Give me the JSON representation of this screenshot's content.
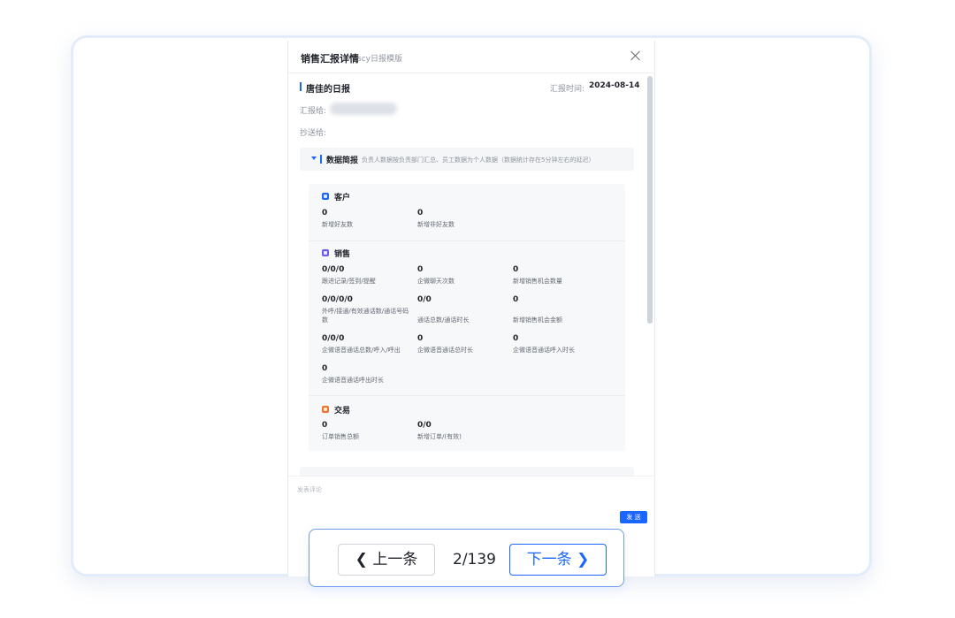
{
  "panel": {
    "title": "销售汇报详情",
    "subtitle": "scy日报模版"
  },
  "report": {
    "name": "唐佳的日报",
    "time_label": "汇报时间:",
    "time_value": "2024-08-14",
    "report_to_label": "汇报给:",
    "cc_label": "抄送给:"
  },
  "data_section": {
    "title": "数据简报",
    "description": "负责人数据按负责部门汇总、员工数据为个人数据（数据统计存在5分钟左右的延迟）",
    "categories": [
      {
        "title": "客户",
        "icon": "customer-icon",
        "color": "#1a66ff",
        "metrics": [
          {
            "value": "0",
            "label": "新增好友数"
          },
          {
            "value": "0",
            "label": "新增非好友数"
          }
        ]
      },
      {
        "title": "销售",
        "icon": "sales-icon",
        "color": "#6b5cf0",
        "metrics": [
          {
            "value": "0/0/0",
            "label": "跟进记录/签到/提醒"
          },
          {
            "value": "0",
            "label": "企微聊天次数"
          },
          {
            "value": "0",
            "label": "新增销售机会数量"
          },
          {
            "value": "0/0/0/0",
            "label": "外呼/接通/有效通话数/通话号码数"
          },
          {
            "value": "0/0",
            "label": "通话总数/通话时长"
          },
          {
            "value": "0",
            "label": "新增销售机会金额"
          },
          {
            "value": "0/0/0",
            "label": "企微语音通话总数/呼入/呼出"
          },
          {
            "value": "0",
            "label": "企微语音通话总时长"
          },
          {
            "value": "0",
            "label": "企微语音通话呼入时长"
          },
          {
            "value": "0",
            "label": "企微语音通话呼出时长"
          }
        ]
      },
      {
        "title": "交易",
        "icon": "trade-icon",
        "color": "#f5722a",
        "metrics": [
          {
            "value": "0",
            "label": "订单销售总额"
          },
          {
            "value": "0/0",
            "label": "新增订单/(有效)"
          }
        ]
      }
    ]
  },
  "comment": {
    "placeholder": "发表评论",
    "send_label": "发 送"
  },
  "pager": {
    "prev_label": "上一条",
    "next_label": "下一条",
    "indicator": "2/139"
  },
  "colors": {
    "accent": "#1a66ff",
    "frame_border": "#e2ecfa",
    "pager_border": "#6f9bf0"
  }
}
